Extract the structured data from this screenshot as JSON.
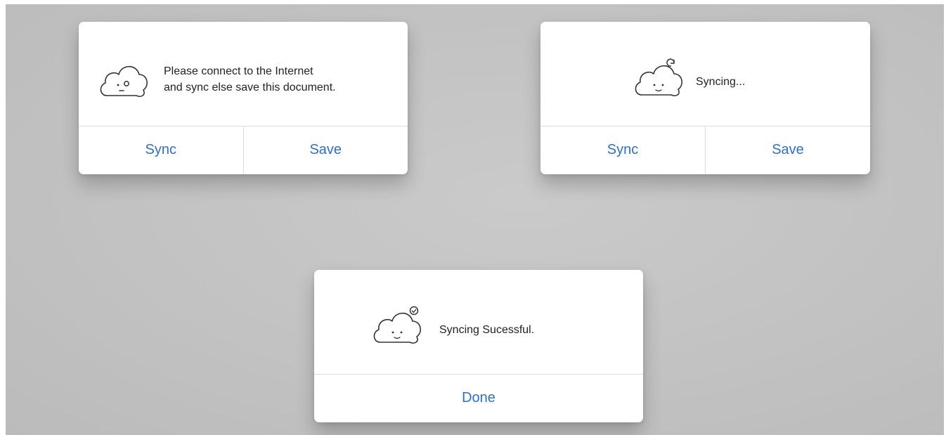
{
  "alerts": {
    "offline": {
      "message_line1": "Please connect to the Internet",
      "message_line2": "and sync else save this document.",
      "icon": "sad-cloud-icon",
      "buttons": {
        "sync": "Sync",
        "save": "Save"
      }
    },
    "syncing": {
      "message": "Syncing...",
      "icon": "cloud-refresh-icon",
      "buttons": {
        "sync": "Sync",
        "save": "Save"
      }
    },
    "success": {
      "message": "Syncing Sucessful.",
      "icon": "cloud-check-icon",
      "buttons": {
        "done": "Done"
      }
    }
  },
  "colors": {
    "button_text": "#2d6fd9",
    "background": "#c4c4c4",
    "alert_background": "#ffffff"
  }
}
